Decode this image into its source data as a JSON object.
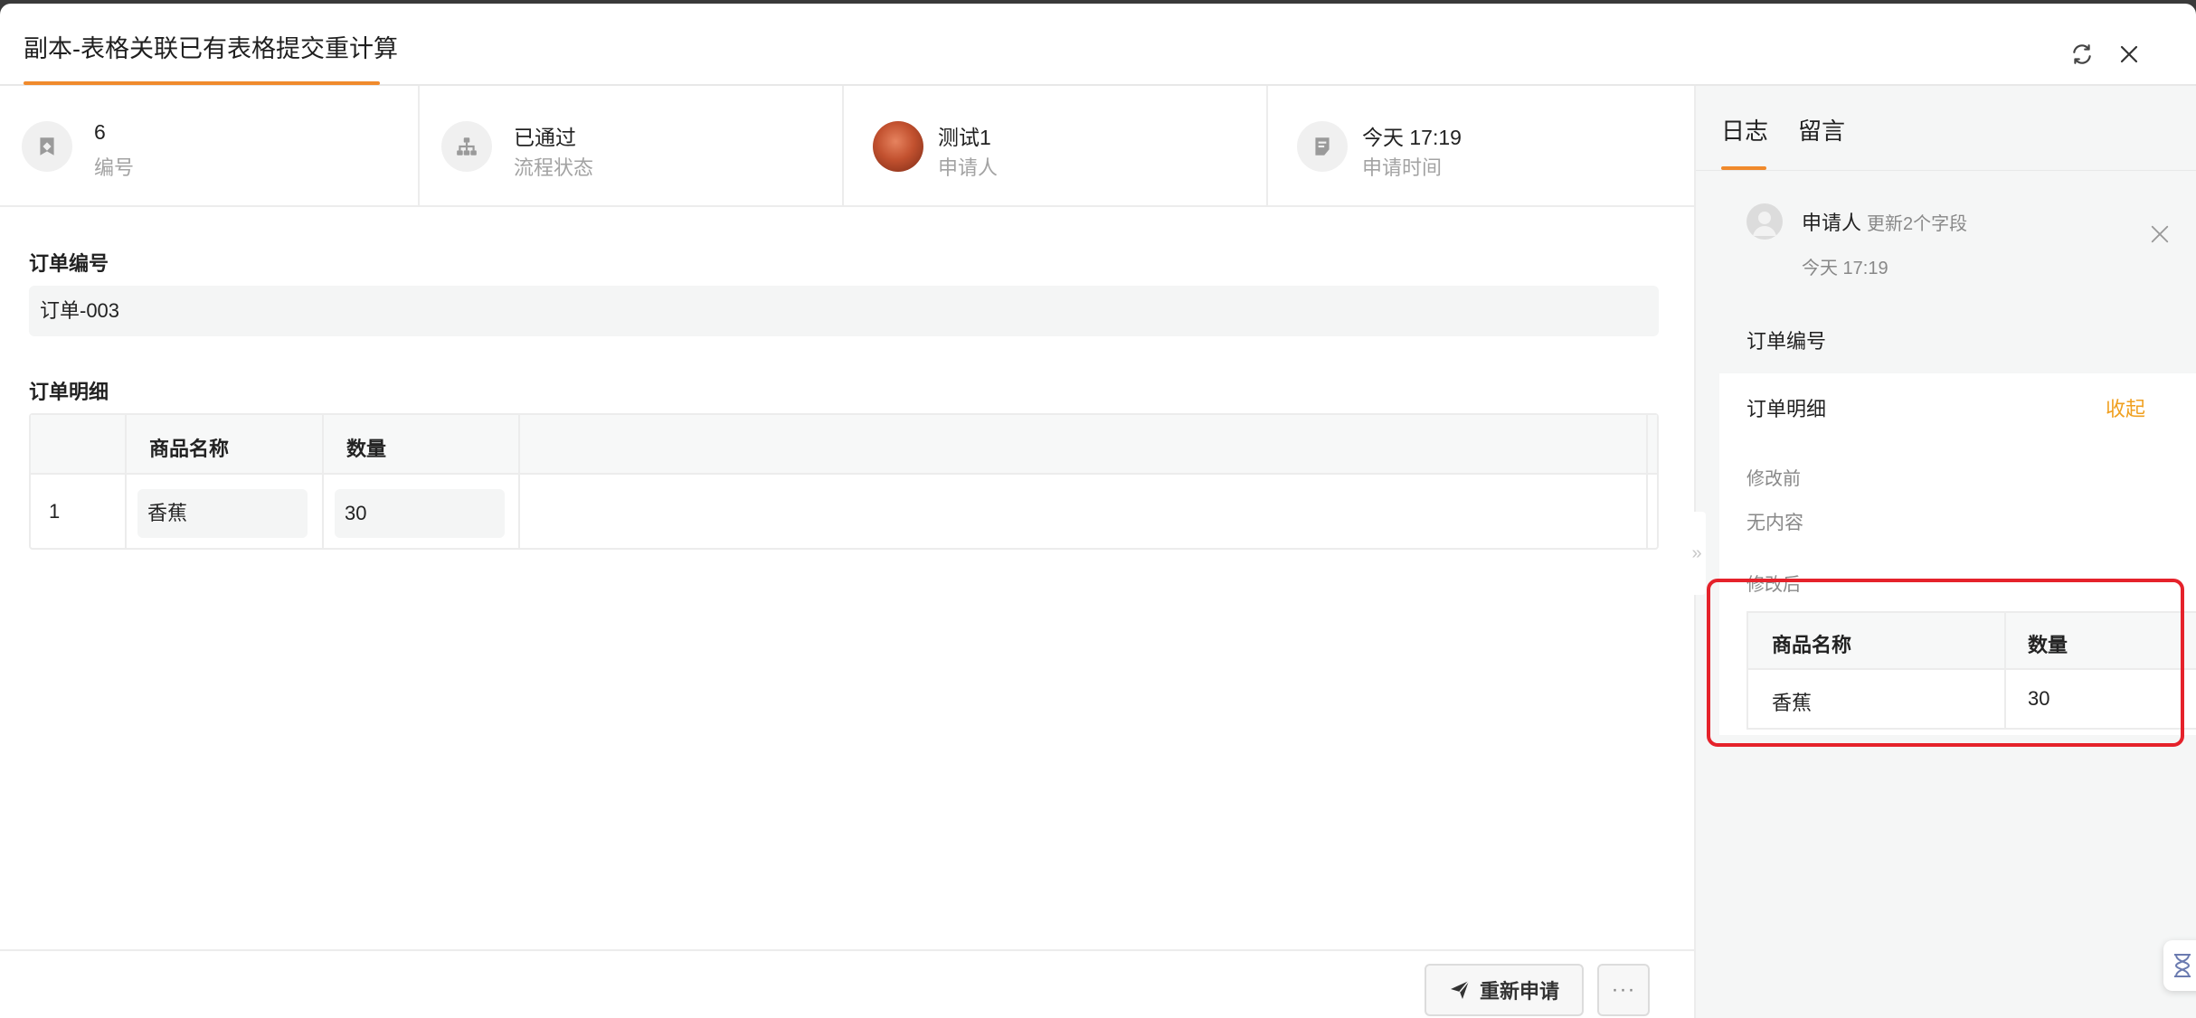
{
  "window": {
    "title": "副本-表格关联已有表格提交重计算",
    "accent_color": "#f08a2c"
  },
  "info": {
    "number": {
      "value": "6",
      "label": "编号"
    },
    "status": {
      "value": "已通过",
      "label": "流程状态"
    },
    "applicant": {
      "value": "测试1",
      "label": "申请人"
    },
    "time": {
      "value": "今天 17:19",
      "label": "申请时间"
    }
  },
  "form": {
    "order_number": {
      "label": "订单编号",
      "value": "订单-003"
    },
    "order_detail": {
      "label": "订单明细",
      "columns": [
        "商品名称",
        "数量"
      ],
      "rows": [
        {
          "index": "1",
          "product": "香蕉",
          "qty": "30"
        }
      ]
    }
  },
  "footer": {
    "resubmit_label": "重新申请",
    "more_label": "···"
  },
  "panel": {
    "tabs": {
      "log": "日志",
      "comments": "留言"
    },
    "log": {
      "user": "申请人",
      "action": "更新2个字段",
      "time": "今天 17:19",
      "field_order_number": "订单编号",
      "detail": {
        "title": "订单明细",
        "collapse_label": "收起",
        "before_label": "修改前",
        "before_value": "无内容",
        "after_label": "修改后",
        "columns": [
          "商品名称",
          "数量"
        ],
        "rows": [
          {
            "product": "香蕉",
            "qty": "30"
          }
        ]
      }
    },
    "collapse_handle": "»",
    "highlight_color": "#e5222b"
  },
  "icons": {
    "refresh": "refresh-icon",
    "close": "close-icon",
    "number": "tag-icon",
    "status": "flow-icon",
    "time": "receipt-icon",
    "send": "send-icon"
  }
}
